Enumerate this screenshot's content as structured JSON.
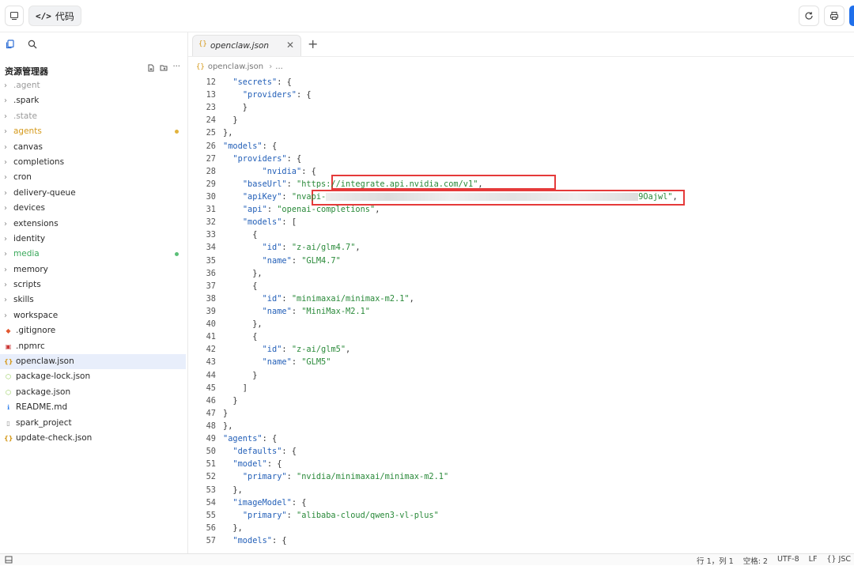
{
  "topbar": {
    "code_label": "代码",
    "code_glyph": "</>"
  },
  "sidebar": {
    "title": "资源管理器",
    "items": [
      {
        "label": ".agent",
        "kind": "folder",
        "style": "muted"
      },
      {
        "label": ".spark",
        "kind": "folder",
        "style": "normal"
      },
      {
        "label": ".state",
        "kind": "folder",
        "style": "muted"
      },
      {
        "label": "agents",
        "kind": "folder",
        "style": "orange",
        "dot": "#e2b33d"
      },
      {
        "label": "canvas",
        "kind": "folder",
        "style": "normal"
      },
      {
        "label": "completions",
        "kind": "folder",
        "style": "normal"
      },
      {
        "label": "cron",
        "kind": "folder",
        "style": "normal"
      },
      {
        "label": "delivery-queue",
        "kind": "folder",
        "style": "normal"
      },
      {
        "label": "devices",
        "kind": "folder",
        "style": "normal"
      },
      {
        "label": "extensions",
        "kind": "folder",
        "style": "normal"
      },
      {
        "label": "identity",
        "kind": "folder",
        "style": "normal"
      },
      {
        "label": "media",
        "kind": "folder",
        "style": "green",
        "dot": "#5bbf78"
      },
      {
        "label": "memory",
        "kind": "folder",
        "style": "normal"
      },
      {
        "label": "scripts",
        "kind": "folder",
        "style": "normal"
      },
      {
        "label": "skills",
        "kind": "folder",
        "style": "normal"
      },
      {
        "label": "workspace",
        "kind": "folder",
        "style": "normal"
      },
      {
        "label": ".gitignore",
        "kind": "file",
        "icon": "git-icon",
        "icon_color": "#e2572f"
      },
      {
        "label": ".npmrc",
        "kind": "file",
        "icon": "npm-icon",
        "icon_color": "#cb3837"
      },
      {
        "label": "openclaw.json",
        "kind": "file",
        "icon": "json-icon",
        "icon_color": "#d59a1c",
        "selected": true
      },
      {
        "label": "package-lock.json",
        "kind": "file",
        "icon": "node-icon",
        "icon_color": "#8cc84b"
      },
      {
        "label": "package.json",
        "kind": "file",
        "icon": "node-icon",
        "icon_color": "#8cc84b"
      },
      {
        "label": "README.md",
        "kind": "file",
        "icon": "info-icon",
        "icon_color": "#2f80ed"
      },
      {
        "label": "spark_project",
        "kind": "file",
        "icon": "file-icon",
        "icon_color": "#8a8a8a"
      },
      {
        "label": "update-check.json",
        "kind": "file",
        "icon": "json-icon",
        "icon_color": "#d59a1c"
      }
    ]
  },
  "editor": {
    "tab_label": "openclaw.json",
    "breadcrumb": "openclaw.json",
    "breadcrumb_more": "...",
    "lines": [
      {
        "n": "12",
        "code": "  <k>\"secrets\"</k>: {"
      },
      {
        "n": "13",
        "code": "    <k>\"providers\"</k>: {"
      },
      {
        "n": "23",
        "code": "    }"
      },
      {
        "n": "24",
        "code": "  }"
      },
      {
        "n": "25",
        "code": "},"
      },
      {
        "n": "26",
        "code": "<k>\"models\"</k>: {"
      },
      {
        "n": "27",
        "code": "  <k>\"providers\"</k>: {"
      },
      {
        "n": "28",
        "code": "        <k>\"nvidia\"</k>: {"
      },
      {
        "n": "29",
        "code": "    <k>\"baseUrl\"</k>: <s>\"https://integrate.api.nvidia.com/v1\"</s>,"
      },
      {
        "n": "30",
        "code": "    <k>\"apiKey\"</k>: <s>\"nvapi-</s><blur></blur><s>9Oajwl\"</s>,"
      },
      {
        "n": "31",
        "code": "    <k>\"api\"</k>: <s>\"openai-completions\"</s>,"
      },
      {
        "n": "32",
        "code": "    <k>\"models\"</k>: ["
      },
      {
        "n": "33",
        "code": "      {"
      },
      {
        "n": "34",
        "code": "        <k>\"id\"</k>: <s>\"z-ai/glm4.7\"</s>,"
      },
      {
        "n": "35",
        "code": "        <k>\"name\"</k>: <s>\"GLM4.7\"</s>"
      },
      {
        "n": "36",
        "code": "      },"
      },
      {
        "n": "37",
        "code": "      {"
      },
      {
        "n": "38",
        "code": "        <k>\"id\"</k>: <s>\"minimaxai/minimax-m2.1\"</s>,"
      },
      {
        "n": "39",
        "code": "        <k>\"name\"</k>: <s>\"MiniMax-M2.1\"</s>"
      },
      {
        "n": "40",
        "code": "      },"
      },
      {
        "n": "41",
        "code": "      {"
      },
      {
        "n": "42",
        "code": "        <k>\"id\"</k>: <s>\"z-ai/glm5\"</s>,"
      },
      {
        "n": "43",
        "code": "        <k>\"name\"</k>: <s>\"GLM5\"</s>"
      },
      {
        "n": "44",
        "code": "      }"
      },
      {
        "n": "45",
        "code": "    ]"
      },
      {
        "n": "46",
        "code": "  }"
      },
      {
        "n": "47",
        "code": "}"
      },
      {
        "n": "48",
        "code": "},"
      },
      {
        "n": "49",
        "code": "<k>\"agents\"</k>: {"
      },
      {
        "n": "50",
        "code": "  <k>\"defaults\"</k>: {"
      },
      {
        "n": "51",
        "code": "  <k>\"model\"</k>: {"
      },
      {
        "n": "52",
        "code": "    <k>\"primary\"</k>: <s>\"nvidia/minimaxai/minimax-m2.1\"</s>"
      },
      {
        "n": "53",
        "code": "  },"
      },
      {
        "n": "54",
        "code": "  <k>\"imageModel\"</k>: {"
      },
      {
        "n": "55",
        "code": "    <k>\"primary\"</k>: <s>\"alibaba-cloud/qwen3-vl-plus\"</s>"
      },
      {
        "n": "56",
        "code": "  },"
      },
      {
        "n": "57",
        "code": "  <k>\"models\"</k>: {"
      }
    ]
  },
  "status": {
    "position": "行 1，列 1",
    "spaces": "空格: 2",
    "encoding": "UTF-8",
    "eol": "LF",
    "language": "{} JSC"
  }
}
